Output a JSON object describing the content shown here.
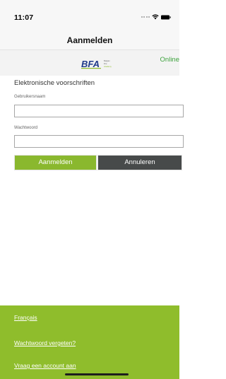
{
  "status_bar": {
    "time": "11:07",
    "icons": [
      "signal-dots-icon",
      "wifi-icon",
      "battery-icon"
    ]
  },
  "nav": {
    "title": "Aanmelden"
  },
  "logo": {
    "text": "BFA",
    "subtitle_lines": [
      "Belgian",
      "Fire",
      "Academy"
    ],
    "colors": {
      "primary": "#1f3a8a",
      "accent": "#8fbd2c"
    }
  },
  "connection_status": "Online",
  "form": {
    "title": "Elektronische voorschriften",
    "username_label": "Gebruikersnaam",
    "username_value": "",
    "password_label": "Wachtwoord",
    "password_value": "",
    "login_button": "Aanmelden",
    "cancel_button": "Annuleren"
  },
  "footer": {
    "language_link": "Français",
    "forgot_password_link": "Wachtwoord vergeten?",
    "request_account_link": "Vraag een account aan"
  },
  "colors": {
    "brand_green": "#8fbd2c",
    "login_button": "#8ab82e",
    "cancel_button": "#474a4a",
    "online_text": "#3ca23c",
    "nav_background": "#f7f7f7"
  }
}
